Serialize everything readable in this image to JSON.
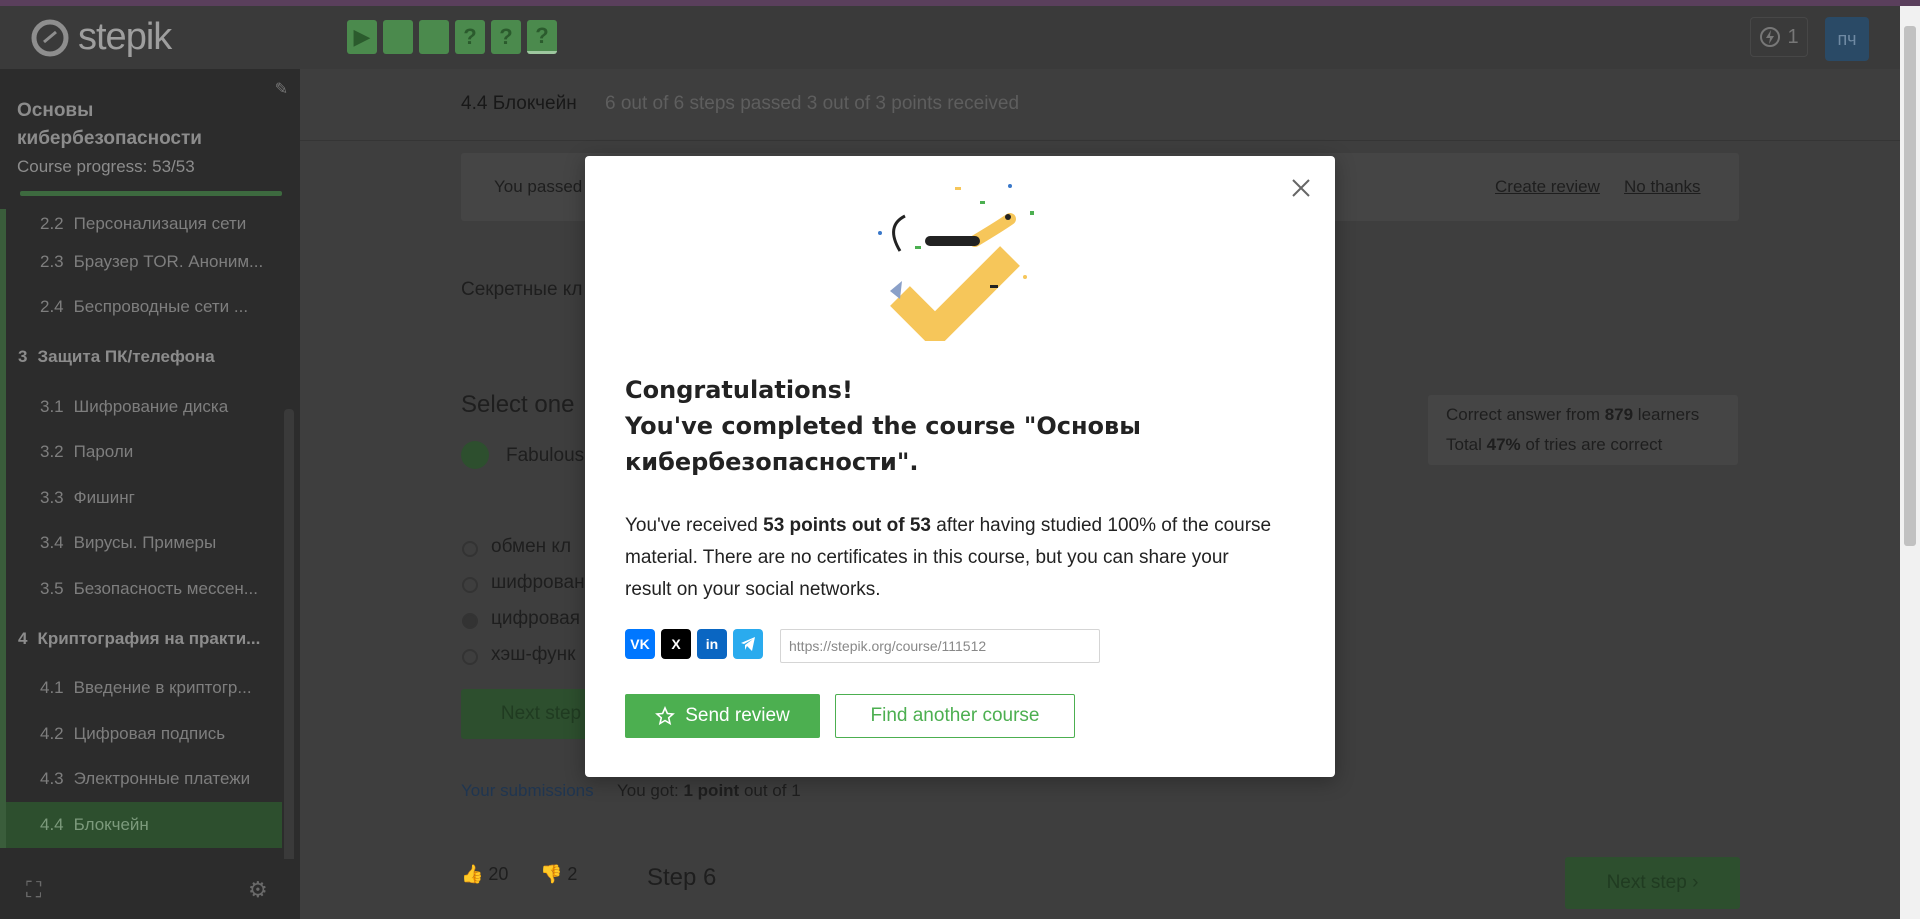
{
  "header": {
    "logo_text": "stepik",
    "step_tabs": [
      "▶",
      "",
      "",
      "?",
      "?",
      "?"
    ],
    "energy_count": "1",
    "avatar_initials": "пч"
  },
  "sidebar": {
    "course_title": "Основы кибербезопасности",
    "progress_label": "Course progress:  53/53",
    "items": [
      {
        "num": "2.2",
        "label": "Персонализация сети"
      },
      {
        "num": "2.3",
        "label": "Браузер TOR. Аноним..."
      },
      {
        "num": "2.4",
        "label": "Беспроводные сети ..."
      }
    ],
    "section3": {
      "num": "3",
      "label": "Защита ПК/телефона"
    },
    "items3": [
      {
        "num": "3.1",
        "label": "Шифрование диска"
      },
      {
        "num": "3.2",
        "label": "Пароли"
      },
      {
        "num": "3.3",
        "label": "Фишинг"
      },
      {
        "num": "3.4",
        "label": "Вирусы. Примеры"
      },
      {
        "num": "3.5",
        "label": "Безопасность мессен..."
      }
    ],
    "section4": {
      "num": "4",
      "label": "Криптография на практи..."
    },
    "items4": [
      {
        "num": "4.1",
        "label": "Введение в криптогр..."
      },
      {
        "num": "4.2",
        "label": "Цифровая подпись"
      },
      {
        "num": "4.3",
        "label": "Электронные платежи"
      },
      {
        "num": "4.4",
        "label": "Блокчейн"
      }
    ]
  },
  "lesson": {
    "title": "4.4 Блокчейн",
    "meta": "6 out of 6 steps passed    3 out of 3 points  received",
    "banner_text": "You passed",
    "create_review": "Create review",
    "no_thanks": "No thanks",
    "secret_text": "Секретные кл",
    "select_one": "Select one",
    "fabulous": "Fabulous",
    "options": [
      "обмен кл",
      "шифрован",
      "цифровая",
      "хэш-функ"
    ],
    "next_step": "Next step",
    "your_submissions": "Your submissions",
    "you_got_prefix": "You got: ",
    "you_got_points": "1 point",
    "you_got_suffix": " out of 1",
    "likes": "20",
    "dislikes": "2",
    "step_label": "Step 6",
    "next_step_bottom": "Next step",
    "stats_line1_prefix": "Correct answer from ",
    "stats_line1_num": "879",
    "stats_line1_suffix": " learners",
    "stats_line2_prefix": "Total ",
    "stats_line2_num": "47%",
    "stats_line2_suffix": " of tries are correct"
  },
  "modal": {
    "heading_line1": "Congratulations!",
    "heading_line2": "You've completed the course \"Основы кибербезопасности\".",
    "body_prefix": "You've received ",
    "body_bold": "53 points out of 53",
    "body_suffix": " after having studied 100% of the course material. There are no certificates in this course, but you can share your result on your social networks.",
    "share_url": "https://stepik.org/course/111512",
    "send_review": "Send review",
    "find_course": "Find another course",
    "share": {
      "vk": "VK",
      "x": "X",
      "linkedin": "in"
    }
  },
  "colors": {
    "accent": "#4caf50",
    "vk": "#0077ff",
    "x": "#000000",
    "linkedin": "#0a66c2",
    "telegram": "#2aabee"
  }
}
